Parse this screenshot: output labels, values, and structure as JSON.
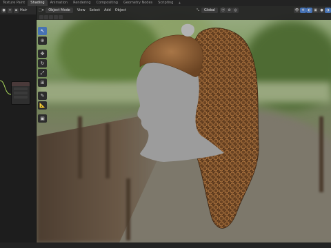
{
  "workspace_tabs": [
    {
      "label": "Texture Paint",
      "active": false
    },
    {
      "label": "Shading",
      "active": true
    },
    {
      "label": "Animation",
      "active": false
    },
    {
      "label": "Rendering",
      "active": false
    },
    {
      "label": "Compositing",
      "active": false
    },
    {
      "label": "Geometry Nodes",
      "active": false
    },
    {
      "label": "Scripting",
      "active": false
    }
  ],
  "add_tab": "+",
  "node_editor": {
    "material_name": "Hair"
  },
  "viewport": {
    "mode": "Object Mode",
    "menus": [
      "View",
      "Select",
      "Add",
      "Object"
    ],
    "orientation": "Global"
  },
  "colors": {
    "accent": "#4772b3",
    "hair": "#6b4423",
    "head": "#9c9c9c"
  }
}
